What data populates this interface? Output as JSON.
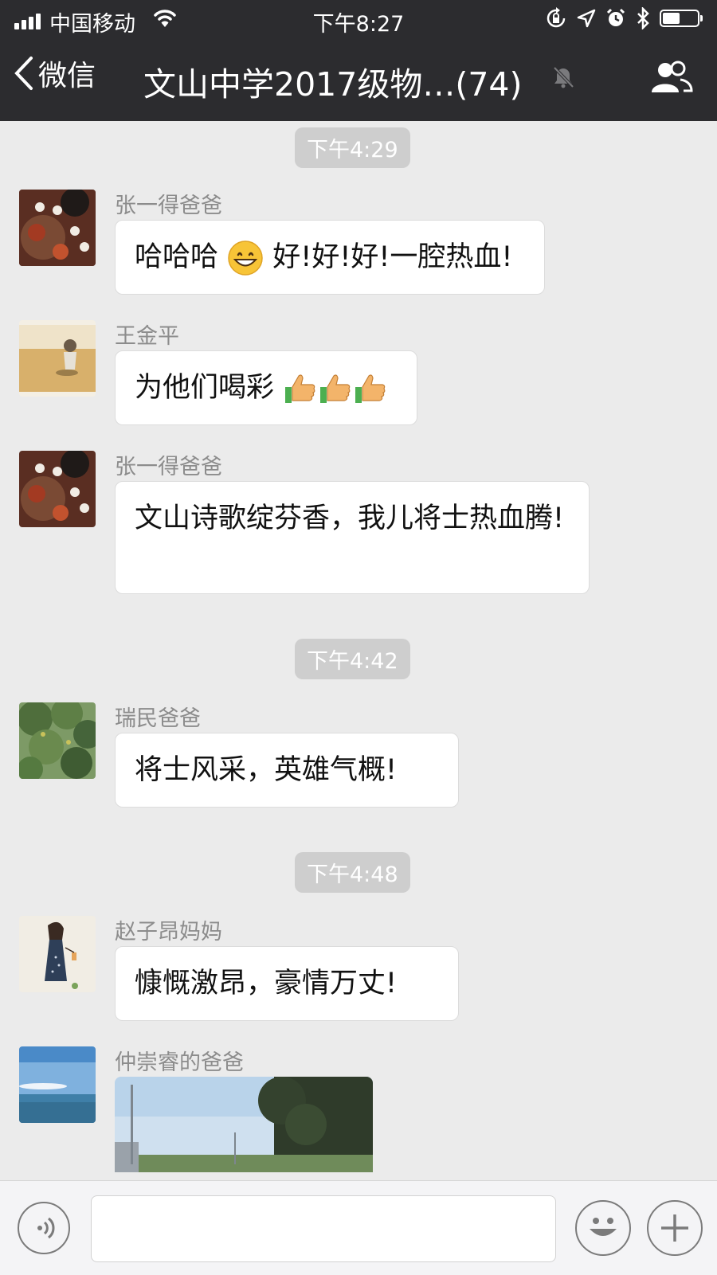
{
  "status_bar": {
    "carrier": "中国移动",
    "time": "下午8:27",
    "battery_level": 0.5
  },
  "nav": {
    "back_label": "微信",
    "title": "文山中学2017级物…(74)",
    "icons": [
      "chevron-left-icon",
      "mute-bell-icon",
      "group-members-icon"
    ]
  },
  "messages": {
    "timestamps": [
      "下午4:29",
      "下午4:42",
      "下午4:48"
    ],
    "items": [
      {
        "sender": "张一得爸爸",
        "text_before": "哈哈哈",
        "emoji": "grinning-face",
        "text_after": " 好!好!好!一腔热血!"
      },
      {
        "sender": "王金平",
        "text": "为他们喝彩",
        "emoji": "thumbs-up x3"
      },
      {
        "sender": "张一得爸爸",
        "text": "文山诗歌绽芬香，我儿将士热血腾!"
      },
      {
        "sender": "瑞民爸爸",
        "text": "将士风采，英雄气概!"
      },
      {
        "sender": "赵子昂妈妈",
        "text": "慷慨激昂，豪情万丈!"
      },
      {
        "sender": "仲崇睿的爸爸",
        "content": "image"
      }
    ]
  },
  "input_bar": {
    "value": "",
    "icons": [
      "voice-icon",
      "emoji-icon",
      "plus-icon"
    ]
  },
  "colors": {
    "nav_bg": "#2c2c2f",
    "chat_bg": "#ebebeb",
    "bubble_bg": "#ffffff",
    "timestamp_bg": "#cecece"
  }
}
